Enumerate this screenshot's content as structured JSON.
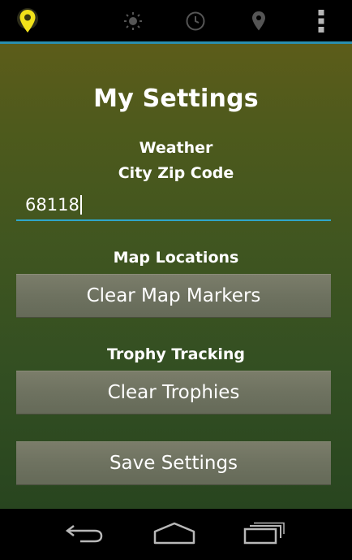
{
  "action_bar": {
    "items": [
      {
        "icon": "map-pin-yellow-icon"
      },
      {
        "icon": "sun-icon"
      },
      {
        "icon": "clock-icon"
      },
      {
        "icon": "location-pin-icon"
      },
      {
        "icon": "overflow-menu-icon"
      }
    ],
    "accent_color": "#2a8fb0",
    "active_icon_color": "#f2e21a"
  },
  "settings": {
    "title": "My Settings",
    "weather_label": "Weather",
    "zip_label": "City Zip Code",
    "zip_value": "68118",
    "map_label": "Map Locations",
    "clear_markers_label": "Clear Map Markers",
    "trophy_label": "Trophy Tracking",
    "clear_trophies_label": "Clear Trophies",
    "save_label": "Save Settings"
  },
  "nav_bar": {
    "items": [
      {
        "icon": "back-icon"
      },
      {
        "icon": "home-icon"
      },
      {
        "icon": "recent-apps-icon"
      }
    ]
  }
}
